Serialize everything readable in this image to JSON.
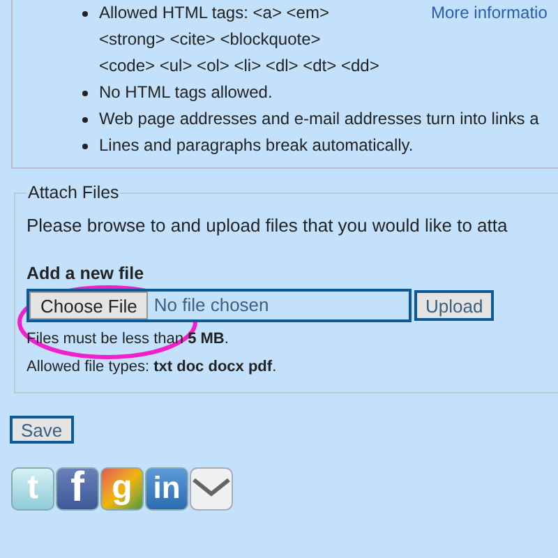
{
  "formatting_tips": {
    "items": [
      {
        "lines": [
          "Allowed HTML tags: <a> <em>",
          "<strong> <cite> <blockquote>",
          "<code> <ul> <ol> <li> <dl> <dt> <dd>"
        ]
      },
      {
        "lines": [
          "No HTML tags allowed."
        ]
      },
      {
        "lines": [
          "Web page addresses and e-mail addresses turn into links a"
        ]
      },
      {
        "lines": [
          "Lines and paragraphs break automatically."
        ]
      }
    ],
    "more_link": "More informatio"
  },
  "attach_files": {
    "legend": "Attach Files",
    "description": "Please browse to and upload files that you would like to atta",
    "add_heading": "Add a new file",
    "choose_button": "Choose File",
    "file_status": "No file chosen",
    "upload_button": "Upload",
    "size_note": "Files must be less than **5 MB**.",
    "types_note": "Allowed file types: **txt doc docx pdf**.",
    "highlighted": true
  },
  "save_button": "Save",
  "share_icons": [
    {
      "kind": "twitter",
      "glyph": "t"
    },
    {
      "kind": "facebook",
      "glyph": "f"
    },
    {
      "kind": "google",
      "glyph": "g"
    },
    {
      "kind": "linkedin",
      "glyph": "in"
    },
    {
      "kind": "email"
    }
  ]
}
